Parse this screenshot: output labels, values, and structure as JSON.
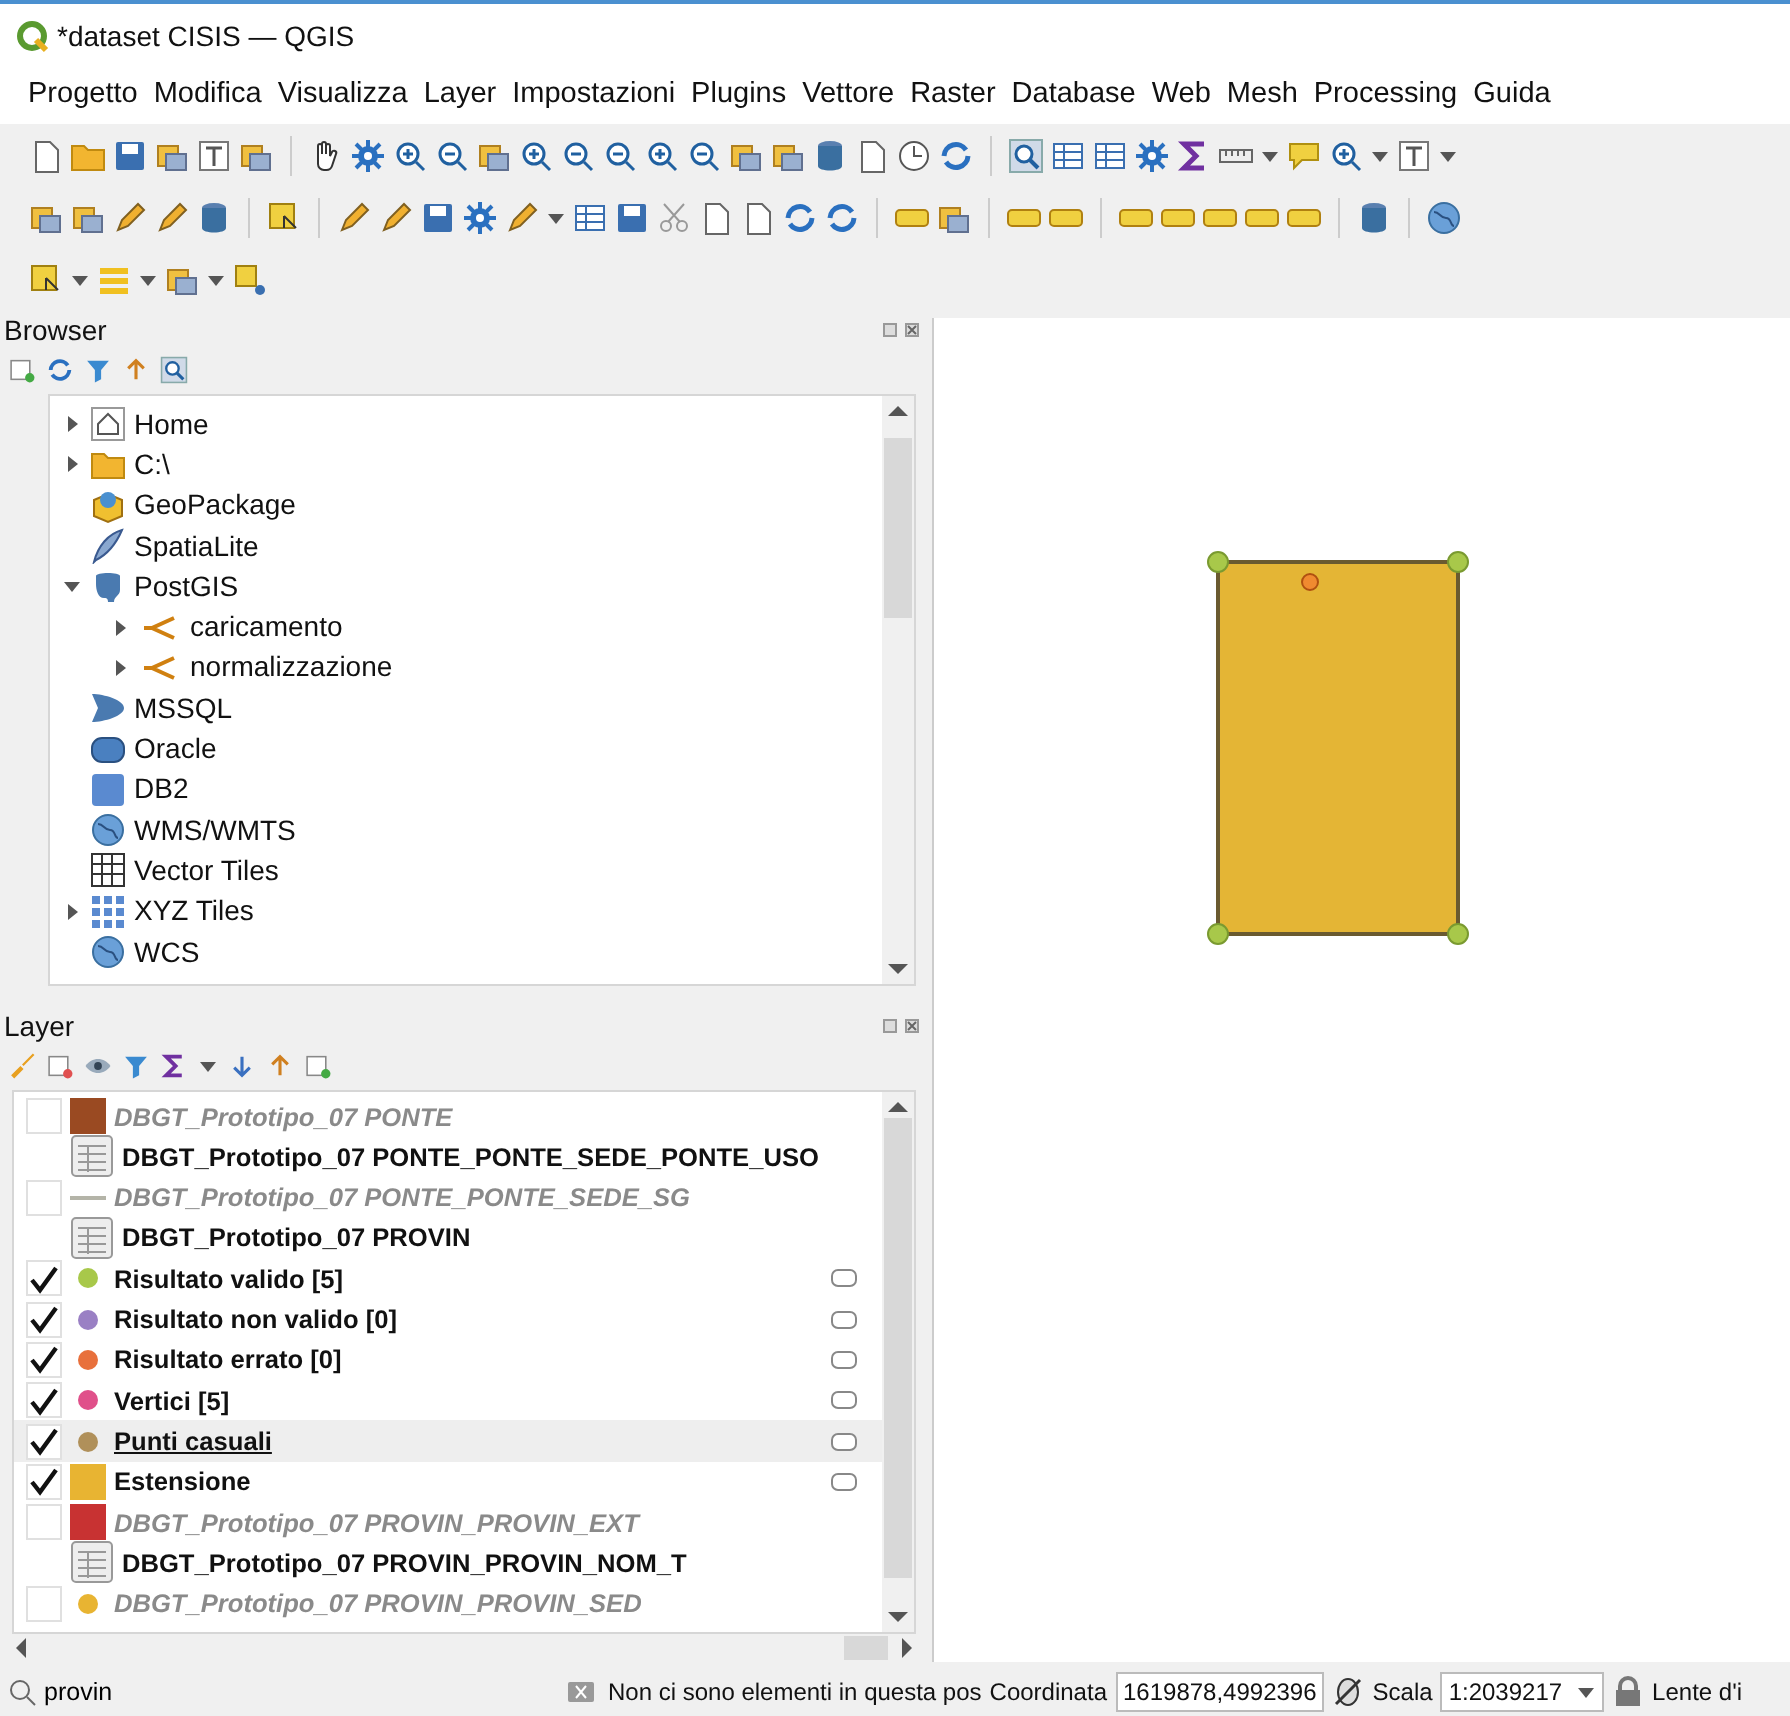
{
  "window": {
    "title": "*dataset CISIS — QGIS"
  },
  "menu": [
    {
      "label": "Progetto"
    },
    {
      "label": "Modifica"
    },
    {
      "label": "Visualizza"
    },
    {
      "label": "Layer"
    },
    {
      "label": "Impostazioni"
    },
    {
      "label": "Plugins"
    },
    {
      "label": "Vettore"
    },
    {
      "label": "Raster"
    },
    {
      "label": "Database"
    },
    {
      "label": "Web"
    },
    {
      "label": "Mesh"
    },
    {
      "label": "Processing"
    },
    {
      "label": "Guida"
    }
  ],
  "browser": {
    "title": "Browser",
    "items": [
      {
        "label": "Home",
        "expanded": false
      },
      {
        "label": "C:\\",
        "expanded": false
      },
      {
        "label": "GeoPackage"
      },
      {
        "label": "SpatiaLite"
      },
      {
        "label": "PostGIS",
        "expanded": true,
        "children": [
          {
            "label": "caricamento",
            "expanded": false
          },
          {
            "label": "normalizzazione",
            "expanded": false
          }
        ]
      },
      {
        "label": "MSSQL"
      },
      {
        "label": "Oracle"
      },
      {
        "label": "DB2"
      },
      {
        "label": "WMS/WMTS"
      },
      {
        "label": "Vector Tiles"
      },
      {
        "label": "XYZ Tiles",
        "expanded": false
      },
      {
        "label": "WCS"
      }
    ]
  },
  "layers": {
    "title": "Layer",
    "items": [
      {
        "label": "DBGT_Prototipo_07 PONTE",
        "kind": "polygon",
        "checked": false,
        "color": "#9a4a22",
        "selected": false
      },
      {
        "label": "DBGT_Prototipo_07 PONTE_PONTE_SEDE_PONTE_USO",
        "kind": "table",
        "selected": false
      },
      {
        "label": "DBGT_Prototipo_07 PONTE_PONTE_SEDE_SG",
        "kind": "line",
        "checked": false,
        "color": "#b4b4a8",
        "selected": false
      },
      {
        "label": "DBGT_Prototipo_07 PROVIN",
        "kind": "table",
        "selected": false
      },
      {
        "label": "Risultato valido [5]",
        "kind": "point",
        "checked": true,
        "color": "#a8c84a",
        "selected": false,
        "indicator": true
      },
      {
        "label": "Risultato non valido [0]",
        "kind": "point",
        "checked": true,
        "color": "#9a80c4",
        "selected": false,
        "indicator": true
      },
      {
        "label": "Risultato errato [0]",
        "kind": "point",
        "checked": true,
        "color": "#e8703c",
        "selected": false,
        "indicator": true
      },
      {
        "label": "Vertici [5]",
        "kind": "point",
        "checked": true,
        "color": "#e0508a",
        "selected": false,
        "indicator": true
      },
      {
        "label": "Punti casuali",
        "kind": "point",
        "checked": true,
        "color": "#b0905a",
        "selected": true,
        "indicator": true
      },
      {
        "label": "Estensione",
        "kind": "polygon",
        "checked": true,
        "color": "#e8b432",
        "selected": false,
        "indicator": true
      },
      {
        "label": "DBGT_Prototipo_07 PROVIN_PROVIN_EXT",
        "kind": "polygon",
        "checked": false,
        "color": "#c83232",
        "selected": false
      },
      {
        "label": "DBGT_Prototipo_07 PROVIN_PROVIN_NOM_T",
        "kind": "table",
        "selected": false
      },
      {
        "label": "DBGT_Prototipo_07 PROVIN_PROVIN_SED",
        "kind": "point",
        "checked": false,
        "color": "#e8b432",
        "selected": false
      }
    ]
  },
  "status_bar": {
    "search": {
      "value": "provin"
    },
    "message": "Non ci sono elementi in questa pos",
    "coordinate_label": "Coordinata",
    "coordinate": "1619878,4992396",
    "scale_label": "Scala",
    "scale": "1:2039217",
    "magnifier_label": "Lente d'i"
  }
}
